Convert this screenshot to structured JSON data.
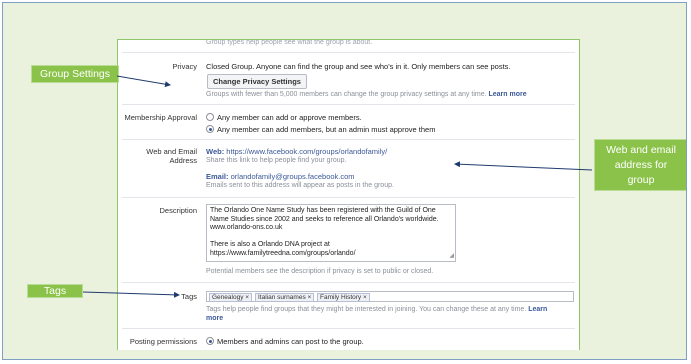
{
  "top_faded_text": "Group types help people see what the group is about.",
  "privacy": {
    "label": "Privacy",
    "value": "Closed Group. Anyone can find the group and see who's in it. Only members can see posts.",
    "button": "Change Privacy Settings",
    "hint_prefix": "Groups with fewer than 5,000 members can change the group privacy settings at any time.",
    "hint_link": "Learn more"
  },
  "membership": {
    "label": "Membership Approval",
    "options": [
      {
        "label": "Any member can add or approve members.",
        "selected": false
      },
      {
        "label": "Any member can add members, but an admin must approve them",
        "selected": true
      }
    ]
  },
  "web_email": {
    "label_line1": "Web and Email",
    "label_line2": "Address",
    "web_prefix": "Web:",
    "web_url": "https://www.facebook.com/groups/orlandofamily/",
    "web_hint": "Share this link to help people find your group.",
    "email_prefix": "Email:",
    "email_value": "orlandofamily@groups.facebook.com",
    "email_hint": "Emails sent to this address will appear as posts in the group."
  },
  "description": {
    "label": "Description",
    "lines": [
      "The Orlando One Name Study has been registered with the Guild of One",
      "Name Studies since 2002 and seeks to reference all Orlando's worldwide.",
      "www.orlando-ons.co.uk",
      "",
      "There is also a Orlando DNA project at",
      "https://www.familytreedna.com/groups/orlando/"
    ],
    "hint": "Potential members see the description if privacy is set to public or closed."
  },
  "tags": {
    "label": "Tags",
    "items": [
      "Genealogy ×",
      "Italian surnames ×",
      "Family History ×"
    ],
    "hint_line1": "Tags help people find groups that they might be interested in joining. You can change these at any time.",
    "hint_link": "Learn",
    "hint_line2": "more"
  },
  "posting": {
    "label": "Posting permissions",
    "option": "Members and admins can post to the group."
  },
  "callouts": {
    "group_settings": "Group Settings",
    "web_email": [
      "Web and email",
      "address for",
      "group"
    ],
    "tags": "Tags"
  },
  "colors": {
    "callout_green": "#8bc34a",
    "background": "#eaf1dd",
    "link_blue": "#3b5998"
  }
}
